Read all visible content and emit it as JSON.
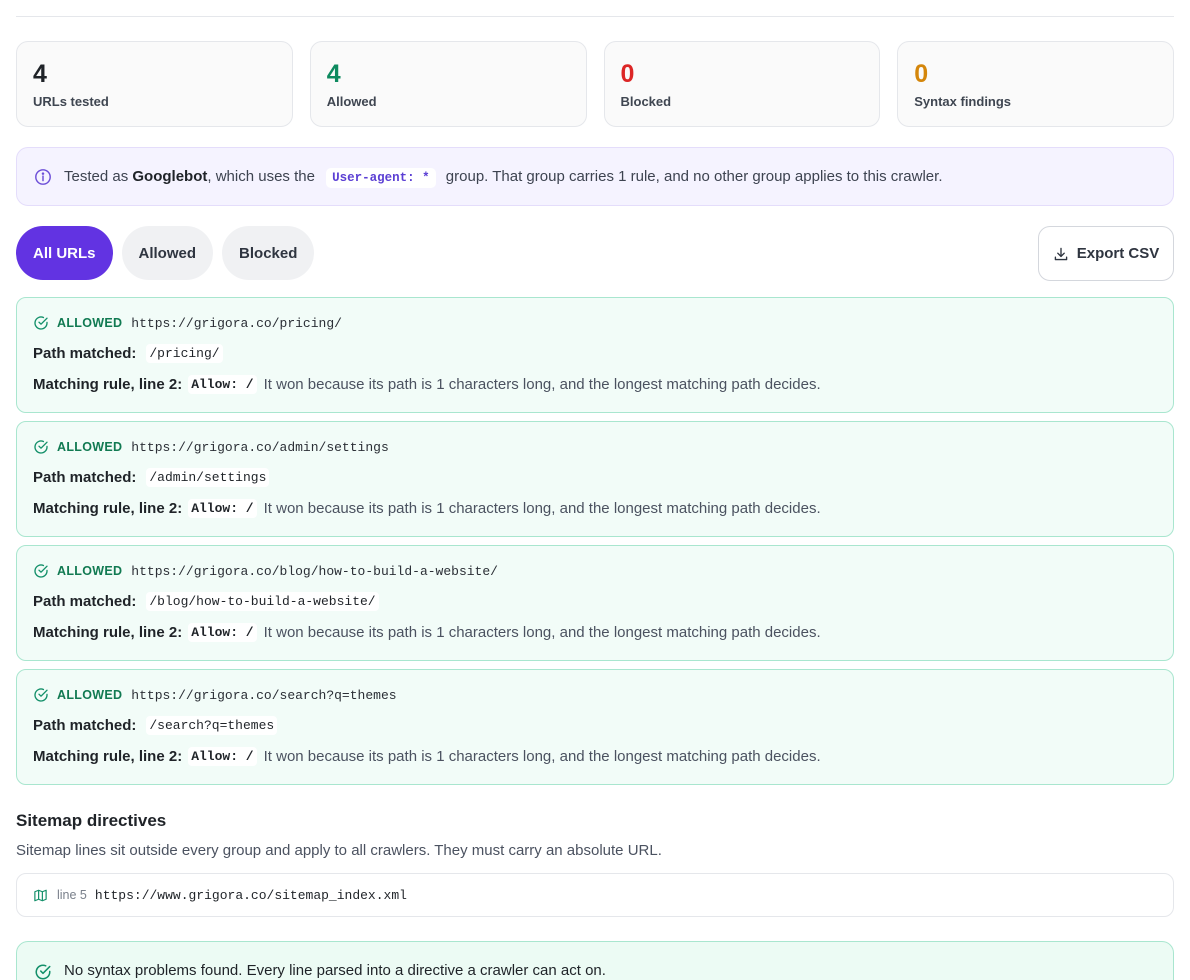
{
  "stats": [
    {
      "value": "4",
      "label": "URLs tested",
      "color": "#1f2328"
    },
    {
      "value": "4",
      "label": "Allowed",
      "color": "#0e8a5f"
    },
    {
      "value": "0",
      "label": "Blocked",
      "color": "#dc2626"
    },
    {
      "value": "0",
      "label": "Syntax findings",
      "color": "#d4860b"
    }
  ],
  "info": {
    "prefix": "Tested as ",
    "bot": "Googlebot",
    "mid": ", which uses the ",
    "group": "User-agent: *",
    "suffix": " group. That group carries 1 rule, and no other group applies to this crawler."
  },
  "tabs": [
    {
      "label": "All URLs",
      "active": true
    },
    {
      "label": "Allowed",
      "active": false
    },
    {
      "label": "Blocked",
      "active": false
    }
  ],
  "export_label": "Export CSV",
  "results": [
    {
      "status": "ALLOWED",
      "url": "https://grigora.co/pricing/",
      "path_label": "Path matched:",
      "path": "/pricing/",
      "rule_label": "Matching rule, line 2:",
      "rule": "Allow: /",
      "explanation": "It won because its path is 1 characters long, and the longest matching path decides."
    },
    {
      "status": "ALLOWED",
      "url": "https://grigora.co/admin/settings",
      "path_label": "Path matched:",
      "path": "/admin/settings",
      "rule_label": "Matching rule, line 2:",
      "rule": "Allow: /",
      "explanation": "It won because its path is 1 characters long, and the longest matching path decides."
    },
    {
      "status": "ALLOWED",
      "url": "https://grigora.co/blog/how-to-build-a-website/",
      "path_label": "Path matched:",
      "path": "/blog/how-to-build-a-website/",
      "rule_label": "Matching rule, line 2:",
      "rule": "Allow: /",
      "explanation": "It won because its path is 1 characters long, and the longest matching path decides."
    },
    {
      "status": "ALLOWED",
      "url": "https://grigora.co/search?q=themes",
      "path_label": "Path matched:",
      "path": "/search?q=themes",
      "rule_label": "Matching rule, line 2:",
      "rule": "Allow: /",
      "explanation": "It won because its path is 1 characters long, and the longest matching path decides."
    }
  ],
  "sitemap": {
    "title": "Sitemap directives",
    "description": "Sitemap lines sit outside every group and apply to all crawlers. They must carry an absolute URL.",
    "entries": [
      {
        "line": "line 5",
        "url": "https://www.grigora.co/sitemap_index.xml"
      }
    ]
  },
  "syntax_banner": "No syntax problems found. Every line parsed into a directive a crawler can act on.",
  "colors": {
    "accent": "#6233e2",
    "allowed": "#0e8a5f",
    "blocked": "#dc2626",
    "warning": "#d4860b"
  },
  "icons": {
    "info": "info-circle-icon",
    "check": "check-circle-icon",
    "export": "download-icon",
    "sitemap": "map-icon"
  }
}
